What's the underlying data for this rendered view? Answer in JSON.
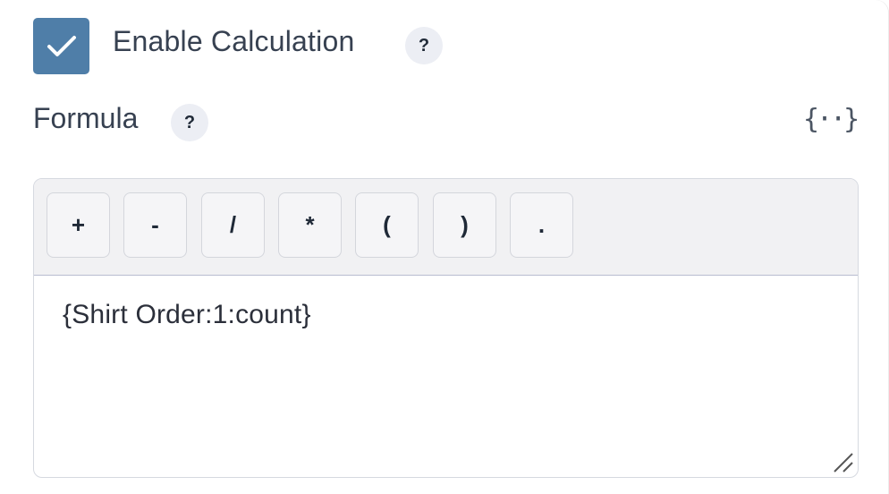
{
  "calculation": {
    "enabled": true,
    "label": "Enable Calculation",
    "help": "?"
  },
  "formula": {
    "label": "Formula",
    "help": "?",
    "smartcode_icon": "{··}",
    "operators": [
      "+",
      "-",
      "/",
      "*",
      "(",
      ")",
      "."
    ],
    "value": "{Shirt Order:1:count}"
  },
  "colors": {
    "checkbox": "#4f7ea8",
    "toolbar_bg": "#f1f1f3",
    "label_text": "#374151"
  }
}
